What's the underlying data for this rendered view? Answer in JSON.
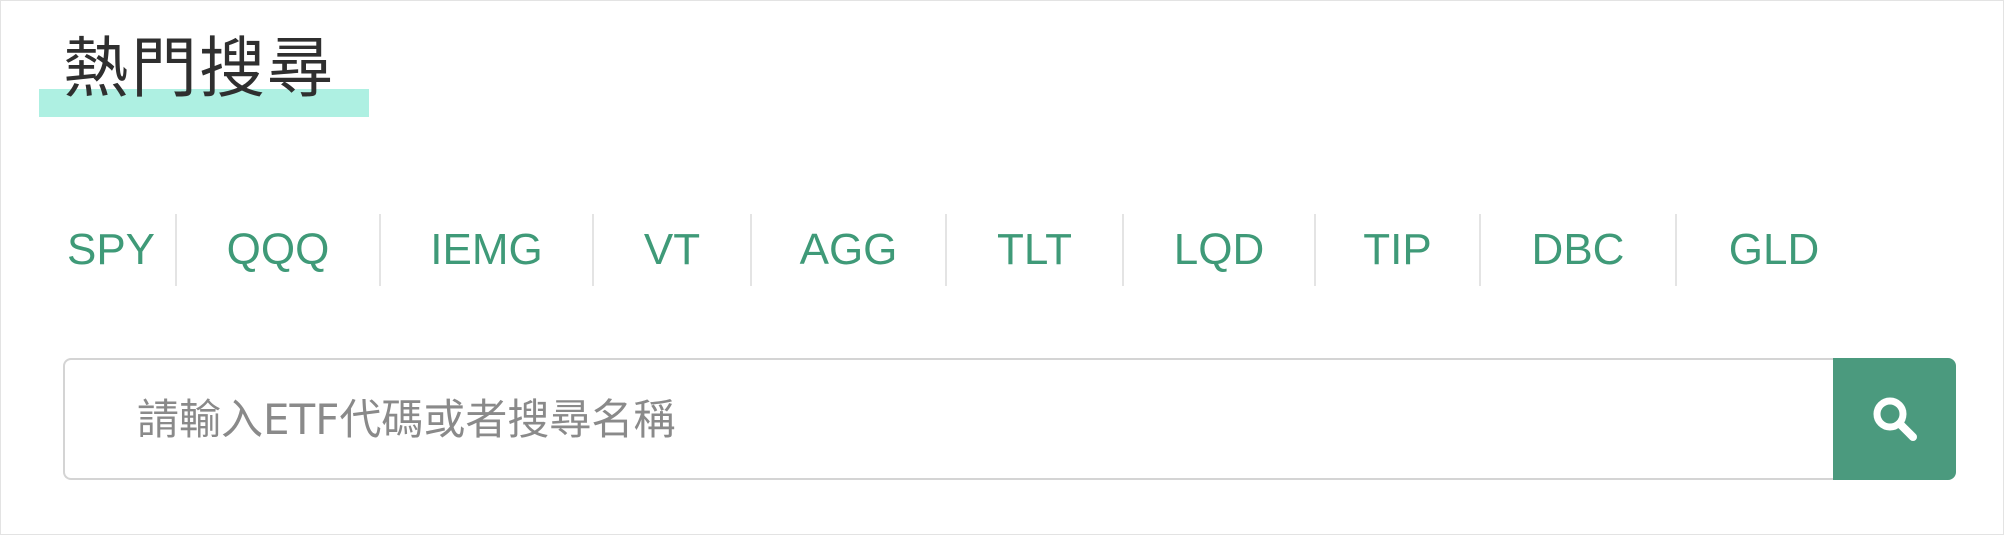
{
  "section": {
    "title": "熱門搜尋"
  },
  "tickers": [
    {
      "label": "SPY"
    },
    {
      "label": "QQQ"
    },
    {
      "label": "IEMG"
    },
    {
      "label": "VT"
    },
    {
      "label": "AGG"
    },
    {
      "label": "TLT"
    },
    {
      "label": "LQD"
    },
    {
      "label": "TIP"
    },
    {
      "label": "DBC"
    },
    {
      "label": "GLD"
    }
  ],
  "search": {
    "placeholder": "請輸入ETF代碼或者搜尋名稱",
    "value": "",
    "button_icon": "search-icon"
  },
  "colors": {
    "accent": "#4b9a7e",
    "ticker_text": "#3f9a78",
    "title_highlight": "#aef0e2",
    "title_text": "#2f2f2f"
  }
}
